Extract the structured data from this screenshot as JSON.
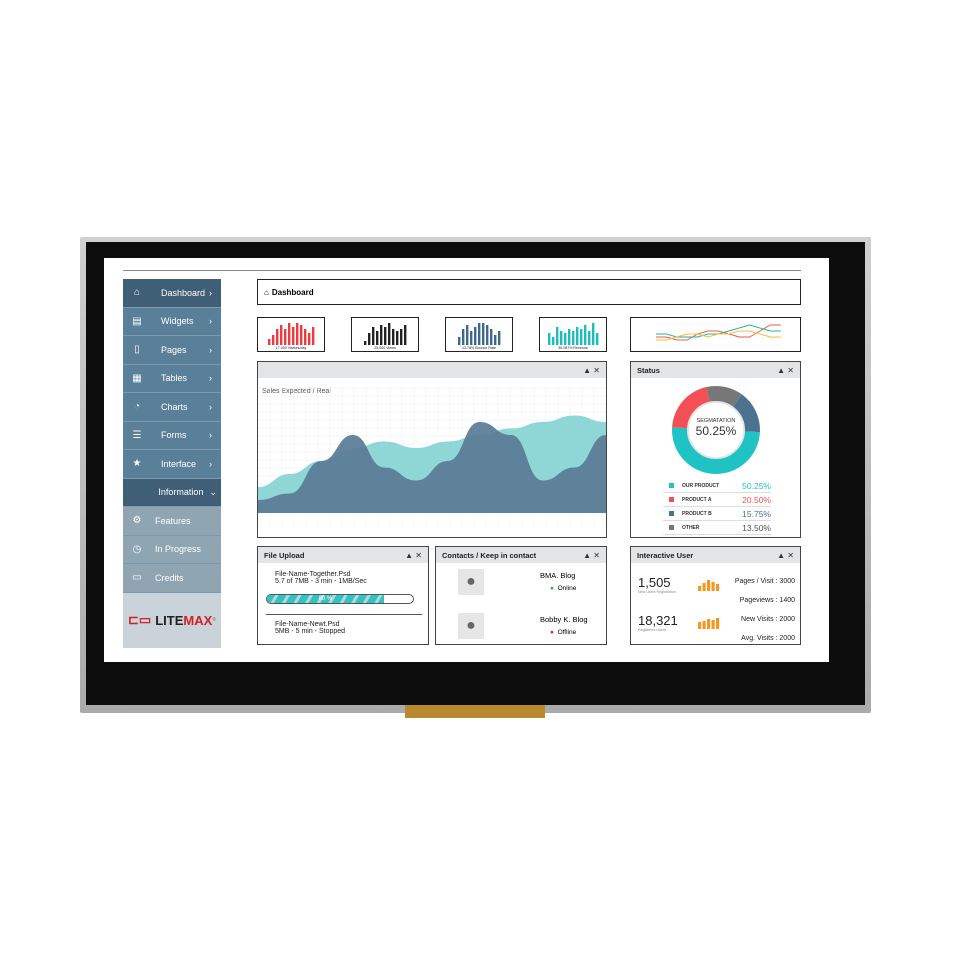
{
  "sidebar": {
    "items": [
      {
        "label": "Dashboard",
        "icon": "home-icon",
        "glyph": "⌂"
      },
      {
        "label": "Widgets",
        "icon": "widgets-icon",
        "glyph": "▤"
      },
      {
        "label": "Pages",
        "icon": "page-icon",
        "glyph": "▯"
      },
      {
        "label": "Tables",
        "icon": "table-icon",
        "glyph": "▦"
      },
      {
        "label": "Charts",
        "icon": "pie-chart-icon",
        "glyph": "◔"
      },
      {
        "label": "Forms",
        "icon": "form-icon",
        "glyph": "☰"
      },
      {
        "label": "Interface",
        "icon": "star-icon",
        "glyph": "★"
      }
    ],
    "section": "Information",
    "sub_items": [
      {
        "label": "Features",
        "icon": "gear-icon",
        "glyph": "⚙"
      },
      {
        "label": "In Progress",
        "icon": "clock-icon",
        "glyph": "◷"
      },
      {
        "label": "Credits",
        "icon": "card-icon",
        "glyph": "▭"
      }
    ],
    "logo": {
      "prefix": "LITE",
      "suffix": "MAX",
      "mark": "®"
    }
  },
  "header": {
    "title": "Dashboard",
    "icon": "home-icon"
  },
  "stats": [
    {
      "label": "17,000 Visitors/day",
      "color": "#f0393e",
      "bars": [
        3,
        5,
        8,
        10,
        8,
        11,
        9,
        11,
        10,
        8,
        6,
        9
      ]
    },
    {
      "label": "25,000 Views",
      "color": "#222222",
      "bars": [
        2,
        6,
        9,
        7,
        10,
        9,
        11,
        8,
        7,
        8,
        10
      ]
    },
    {
      "label": "13.78% Bounce Rate",
      "color": "#3d6a8c",
      "bars": [
        4,
        8,
        10,
        7,
        9,
        11,
        11,
        10,
        8,
        5,
        7
      ]
    },
    {
      "label": "35.087% Revenue",
      "color": "#1bbdbf",
      "bars": [
        6,
        4,
        9,
        7,
        6,
        8,
        7,
        9,
        8,
        10,
        7,
        11,
        6
      ]
    }
  ],
  "mini_line": {
    "series": [
      {
        "color": "#f05a5a",
        "values": [
          3,
          3,
          2,
          2,
          4,
          5,
          5,
          4,
          3,
          3,
          5,
          7,
          7
        ]
      },
      {
        "color": "#2cb59a",
        "values": [
          4,
          4,
          3,
          3,
          3,
          4,
          4,
          5,
          6,
          7,
          6,
          5,
          5
        ]
      },
      {
        "color": "#f4c03a",
        "values": [
          2,
          2,
          3,
          4,
          4,
          3,
          4,
          4,
          5,
          5,
          4,
          3,
          3
        ]
      }
    ]
  },
  "sales": {
    "title": "Sales Expected / Real",
    "controls": "▲ ✕",
    "expected": [
      2,
      3,
      4,
      5,
      5.5,
      5,
      5.5,
      6,
      6.5,
      7,
      7.5,
      7
    ],
    "real": [
      1,
      1.5,
      4,
      6,
      3.5,
      2.5,
      4,
      7,
      6,
      2.5,
      3.5,
      6
    ],
    "colors": {
      "expected": "#8fd7d6",
      "real": "#5d7d98"
    }
  },
  "status": {
    "title": "Status",
    "controls": "▲ ✕",
    "center_label": "SEGMATATION",
    "center_value": "50.25%",
    "legend": [
      {
        "label": "OUR PRODUCT",
        "value": "50.25%",
        "color": "#1fc3c3",
        "share": 50.25
      },
      {
        "label": "PRODUCT A",
        "value": "20.50%",
        "color": "#f25056",
        "share": 20.5
      },
      {
        "label": "PRODUCT B",
        "value": "15.75%",
        "color": "#4c7290",
        "share": 15.75
      },
      {
        "label": "OTHER",
        "value": "13.50%",
        "color": "#777777",
        "share": 13.5
      }
    ]
  },
  "upload": {
    "title": "File Upload",
    "controls": "▲ ✕",
    "file1": {
      "name": "File-Name-Together.Psd",
      "info": "5.7 of 7MB - 3 min - 1MB/Sec"
    },
    "progress": 80,
    "progress_label": "80 %",
    "file2": {
      "name": "File-Name-Newt.Psd",
      "info": "5MB - 5 min - Stopped"
    }
  },
  "contacts": {
    "title": "Contacts / Keep in contact",
    "controls": "▲ ✕",
    "people": [
      {
        "name": "BMA. Blog",
        "status": "Online",
        "color": "#22aa55"
      },
      {
        "name": "Bobby K. Blog",
        "status": "Offline",
        "color": "#e02020"
      }
    ]
  },
  "interactive": {
    "title": "Interactive User",
    "controls": "▲ ✕",
    "metrics": [
      {
        "value": "1,505",
        "label": "New Users Registration"
      },
      {
        "value": "18,321",
        "label": "Registered Users"
      }
    ],
    "stats": [
      "Pages / Visit : 3000",
      "Pageviews : 1400",
      "New Visits : 2000",
      "Avg. Visits : 2000"
    ]
  }
}
